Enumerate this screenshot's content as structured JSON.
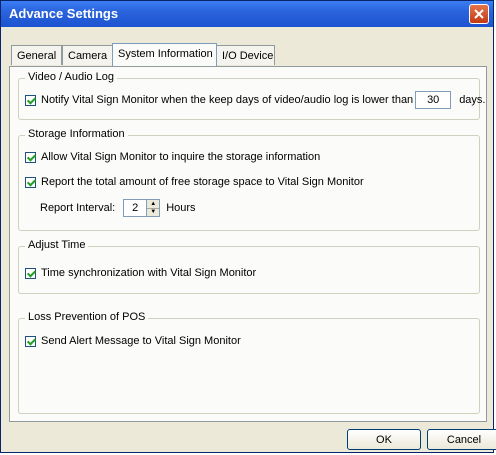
{
  "window": {
    "title": "Advance Settings",
    "close_icon": "close-icon"
  },
  "tabs": [
    {
      "label": "General"
    },
    {
      "label": "Camera"
    },
    {
      "label": "System Information",
      "active": true
    },
    {
      "label": "I/O Device"
    }
  ],
  "groups": {
    "video_audio_log": {
      "title": "Video / Audio Log",
      "notify_label": "Notify Vital Sign Monitor when the keep days of video/audio log is lower than",
      "notify_checked": true,
      "days_value": "30",
      "days_unit": "days."
    },
    "storage_information": {
      "title": "Storage Information",
      "allow_label": "Allow Vital Sign  Monitor to inquire the storage information",
      "allow_checked": true,
      "report_label": "Report the total amount of free storage space to Vital Sign Monitor",
      "report_checked": true,
      "interval_label": "Report Interval:",
      "interval_value": "2",
      "interval_unit": "Hours"
    },
    "adjust_time": {
      "title": "Adjust Time",
      "sync_label": "Time synchronization with Vital Sign Monitor",
      "sync_checked": true
    },
    "loss_prevention": {
      "title": "Loss Prevention of POS",
      "alert_label": "Send Alert Message to Vital Sign Monitor",
      "alert_checked": true
    }
  },
  "buttons": {
    "ok": "OK",
    "cancel": "Cancel"
  },
  "colors": {
    "title_bar": "#1c53d0",
    "close_button": "#c23a14",
    "dialog_bg": "#ece9d8",
    "checkmark": "#21a121"
  }
}
